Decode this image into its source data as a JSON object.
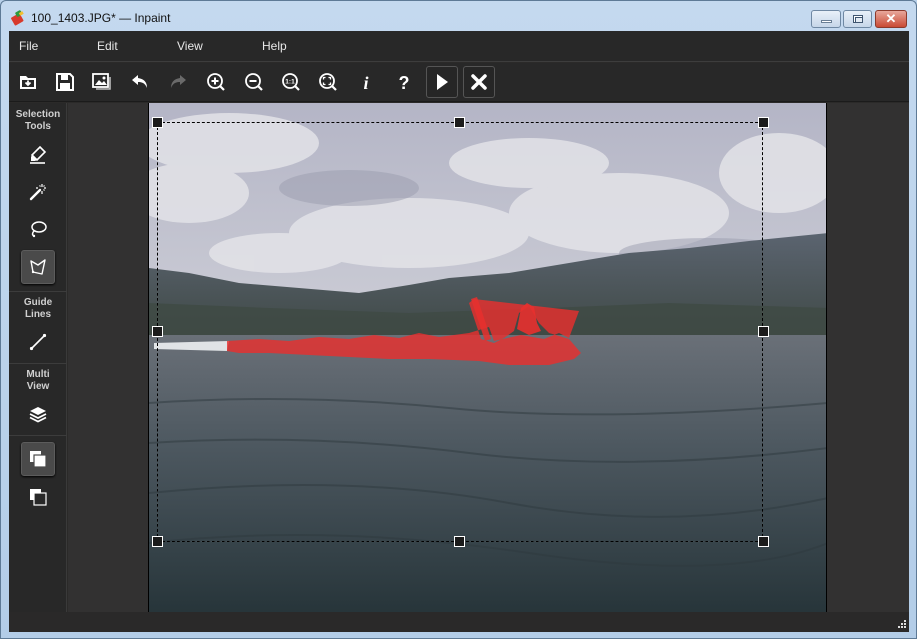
{
  "window": {
    "title": "100_1403.JPG* — Inpaint",
    "buttons": {
      "minimize": "minimize",
      "maximize": "maximize",
      "close": "✕"
    }
  },
  "menu": [
    {
      "label": "File"
    },
    {
      "label": "Edit"
    },
    {
      "label": "View"
    },
    {
      "label": "Help"
    }
  ],
  "toolbar": [
    {
      "icon": "open-icon",
      "tooltip": "Open"
    },
    {
      "icon": "save-icon",
      "tooltip": "Save"
    },
    {
      "icon": "image-icon",
      "tooltip": "Image"
    },
    {
      "icon": "undo-icon",
      "tooltip": "Undo",
      "enabled": true
    },
    {
      "icon": "redo-icon",
      "tooltip": "Redo",
      "enabled": false
    },
    {
      "icon": "zoom-in-icon",
      "tooltip": "Zoom In"
    },
    {
      "icon": "zoom-out-icon",
      "tooltip": "Zoom Out"
    },
    {
      "icon": "zoom-actual-icon",
      "tooltip": "Actual Size",
      "text": "1:1"
    },
    {
      "icon": "zoom-fit-icon",
      "tooltip": "Fit"
    },
    {
      "icon": "info-icon",
      "tooltip": "Info",
      "text": "i"
    },
    {
      "icon": "help-icon",
      "tooltip": "Help",
      "text": "?"
    },
    {
      "icon": "play-icon",
      "tooltip": "Process"
    },
    {
      "icon": "cancel-icon",
      "tooltip": "Cancel"
    }
  ],
  "sidebar": {
    "sections": [
      {
        "label": "Selection Tools",
        "line1": "Selection",
        "line2": "Tools",
        "tools": [
          {
            "icon": "marker-icon",
            "active": false
          },
          {
            "icon": "magic-wand-icon",
            "active": false
          },
          {
            "icon": "lasso-icon",
            "active": false
          },
          {
            "icon": "polygon-lasso-icon",
            "active": true
          }
        ]
      },
      {
        "label": "Guide Lines",
        "line1": "Guide",
        "line2": "Lines",
        "tools": [
          {
            "icon": "guide-line-icon",
            "active": false
          }
        ]
      },
      {
        "label": "Multi View",
        "line1": "Multi",
        "line2": "View",
        "tools": [
          {
            "icon": "layers-icon",
            "active": false
          }
        ]
      }
    ],
    "view_modes": [
      {
        "icon": "view-filled-icon",
        "active": true
      },
      {
        "icon": "view-outline-icon",
        "active": false
      }
    ]
  },
  "canvas": {
    "image_description": "Lake with mountains, cloudy sky, jet ski with wake highlighted in red selection mask",
    "mask_color": "#e8302e",
    "selection": "dashed rectangular crop with 8 handles"
  }
}
